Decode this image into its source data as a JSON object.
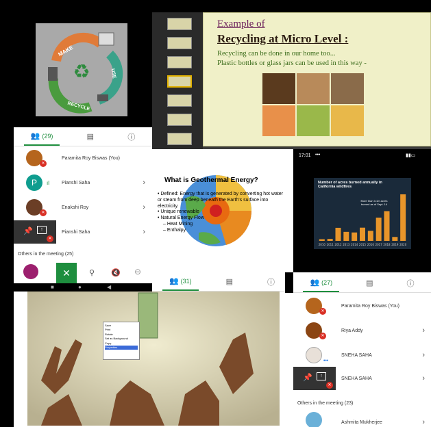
{
  "panels": {
    "recycle": {
      "make": "MAKE",
      "use": "USE",
      "recycle": "RECYCLE"
    },
    "tabs_top_left": {
      "people_count": "(29)"
    },
    "slide": {
      "heading": "Example of",
      "title": "Recycling at Micro Level :",
      "line1": "Recycling can be done in our home too...",
      "line2": "Plastic bottles or glass jars can be used in this way -"
    },
    "participants_left": {
      "rows": [
        {
          "name": "Paramita Roy Biswas (You)",
          "avatar_color": "#b5651d"
        },
        {
          "name": "Pianshi Saha",
          "avatar_letter": "P",
          "avatar_color": "#0f9d8f"
        },
        {
          "name": "Enakshi Roy",
          "avatar_color": "#6b3e26"
        },
        {
          "name": "Pianshi Saha",
          "avatar_color": "#333333"
        }
      ],
      "others_label": "Others in the meeting (25)"
    },
    "geothermal": {
      "title": "What is Geothermal Energy?",
      "bullets": [
        "Defined: Energy that is generated by converting hot water or steam from deep beneath the Earth's surface into electricity.",
        "Unique renewable",
        "Natural Energy Flow"
      ],
      "sub_bullets": [
        "– Heat Mining",
        "– Enthalpy"
      ]
    },
    "tabs_center": {
      "people_count": "(31)"
    },
    "phone_chart": {
      "status_time": "17:01",
      "status_dots": "•••",
      "title": "Number of acres burned annually in California wildfires",
      "note": "More than 3.1m acres burned as of Sept. 14"
    },
    "tabs_right": {
      "people_count": "(27)"
    },
    "participants_right": {
      "rows": [
        {
          "name": "Paramita Roy Biswas (You)",
          "avatar_color": "#b5651d"
        },
        {
          "name": "Riya Addy",
          "avatar_color": "#8b4513"
        },
        {
          "name": "SNEHA SAHA",
          "avatar_color": "#e8e0d8"
        },
        {
          "name": "SNEHA SAHA",
          "avatar_color": "#333333"
        }
      ],
      "others_label": "Others in the meeting (23)",
      "last_row": "Ashmita Mukherjee"
    },
    "money_menu": {
      "items": [
        "Save",
        "Print",
        "Rotate",
        "Set as Background",
        "Copy",
        "Properties"
      ]
    }
  },
  "colors": {
    "slide_bg": "#f0f0c8",
    "slide_title": "#2a1a10",
    "slide_heading": "#6a1e5a",
    "slide_text": "#3a6b1a",
    "accent_green": "#1e8e3e",
    "accent_blue": "#1a73e8",
    "mic_off_red": "#d93025",
    "chart_bar": "#e8952a"
  },
  "chart_data": {
    "type": "bar",
    "title": "Number of acres burned annually in California wildfires",
    "categories": [
      "2010",
      "2011",
      "2012",
      "2013",
      "2014",
      "2015",
      "2016",
      "2017",
      "2018",
      "2019",
      "2020"
    ],
    "values": [
      0.11,
      0.13,
      0.87,
      0.6,
      0.56,
      0.88,
      0.67,
      1.55,
      1.98,
      0.26,
      3.1
    ]
  }
}
